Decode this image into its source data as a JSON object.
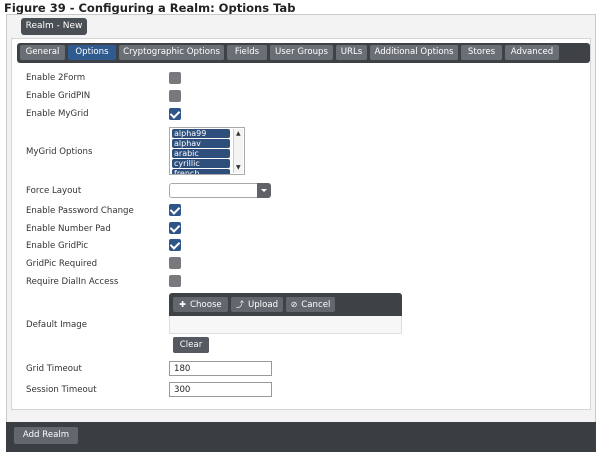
{
  "figure_title": "Figure 39 - Configuring a Realm: Options Tab",
  "realm_tab": "Realm - New",
  "tabs": [
    {
      "label": "General"
    },
    {
      "label": "Options"
    },
    {
      "label": "Cryptographic Options"
    },
    {
      "label": "Fields"
    },
    {
      "label": "User Groups"
    },
    {
      "label": "URLs"
    },
    {
      "label": "Additional Options"
    },
    {
      "label": "Stores"
    },
    {
      "label": "Advanced"
    }
  ],
  "active_tab": "Options",
  "options": {
    "enable_2form": {
      "label": "Enable 2Form",
      "checked": false
    },
    "enable_gridpin": {
      "label": "Enable GridPIN",
      "checked": false
    },
    "enable_mygrid": {
      "label": "Enable MyGrid",
      "checked": true
    },
    "mygrid_options": {
      "label": "MyGrid Options",
      "items": [
        "alpha99",
        "alphav",
        "arabic",
        "cyrillic",
        "french"
      ]
    },
    "force_layout": {
      "label": "Force Layout",
      "value": ""
    },
    "enable_password_change": {
      "label": "Enable Password Change",
      "checked": true
    },
    "enable_number_pad": {
      "label": "Enable Number Pad",
      "checked": true
    },
    "enable_gridpic": {
      "label": "Enable GridPic",
      "checked": true
    },
    "gridpic_required": {
      "label": "GridPic Required",
      "checked": false
    },
    "require_dialin_access": {
      "label": "Require DialIn Access",
      "checked": false
    },
    "default_image": {
      "label": "Default Image",
      "choose_label": "Choose",
      "upload_label": "Upload",
      "cancel_label": "Cancel",
      "clear_label": "Clear"
    },
    "grid_timeout": {
      "label": "Grid Timeout",
      "value": "180"
    },
    "session_timeout": {
      "label": "Session Timeout",
      "value": "300"
    }
  },
  "footer": {
    "add_realm_label": "Add Realm"
  },
  "colors": {
    "accent": "#2f5b8f",
    "checkbox_checked": "#2e5587",
    "toolbar": "#3e4247"
  }
}
